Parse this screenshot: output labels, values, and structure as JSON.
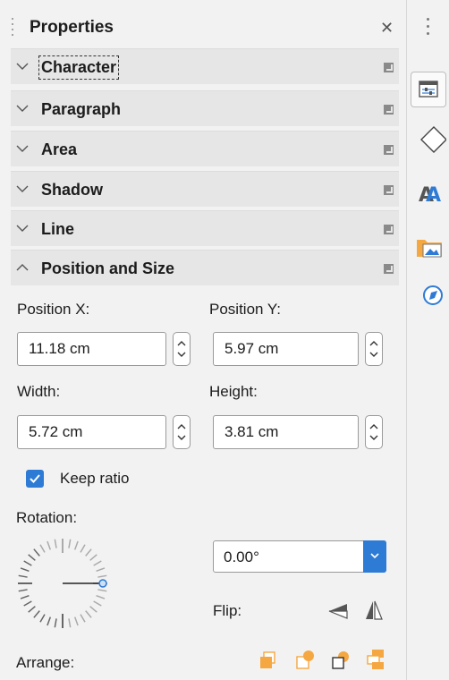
{
  "panel": {
    "title": "Properties",
    "close_icon": "close-icon"
  },
  "sections": [
    {
      "label": "Character",
      "expanded": false
    },
    {
      "label": "Paragraph",
      "expanded": false
    },
    {
      "label": "Area",
      "expanded": false
    },
    {
      "label": "Shadow",
      "expanded": false
    },
    {
      "label": "Line",
      "expanded": false
    },
    {
      "label": "Position and Size",
      "expanded": true
    }
  ],
  "position_size": {
    "pos_x_label": "Position X:",
    "pos_x_value": "11.18 cm",
    "pos_y_label": "Position Y:",
    "pos_y_value": "5.97 cm",
    "width_label": "Width:",
    "width_value": "5.72 cm",
    "height_label": "Height:",
    "height_value": "3.81 cm",
    "keep_ratio_label": "Keep ratio",
    "keep_ratio_checked": true,
    "rotation_label": "Rotation:",
    "rotation_value": "0.00°",
    "flip_label": "Flip:",
    "arrange_label": "Arrange:"
  },
  "sidebar": {
    "tabs": [
      "properties-icon",
      "shapes-icon",
      "styles-icon",
      "gallery-icon",
      "navigator-icon"
    ],
    "active": "properties-icon"
  },
  "colors": {
    "accent": "#2e7bd6",
    "arrange_orange": "#f5a742"
  }
}
